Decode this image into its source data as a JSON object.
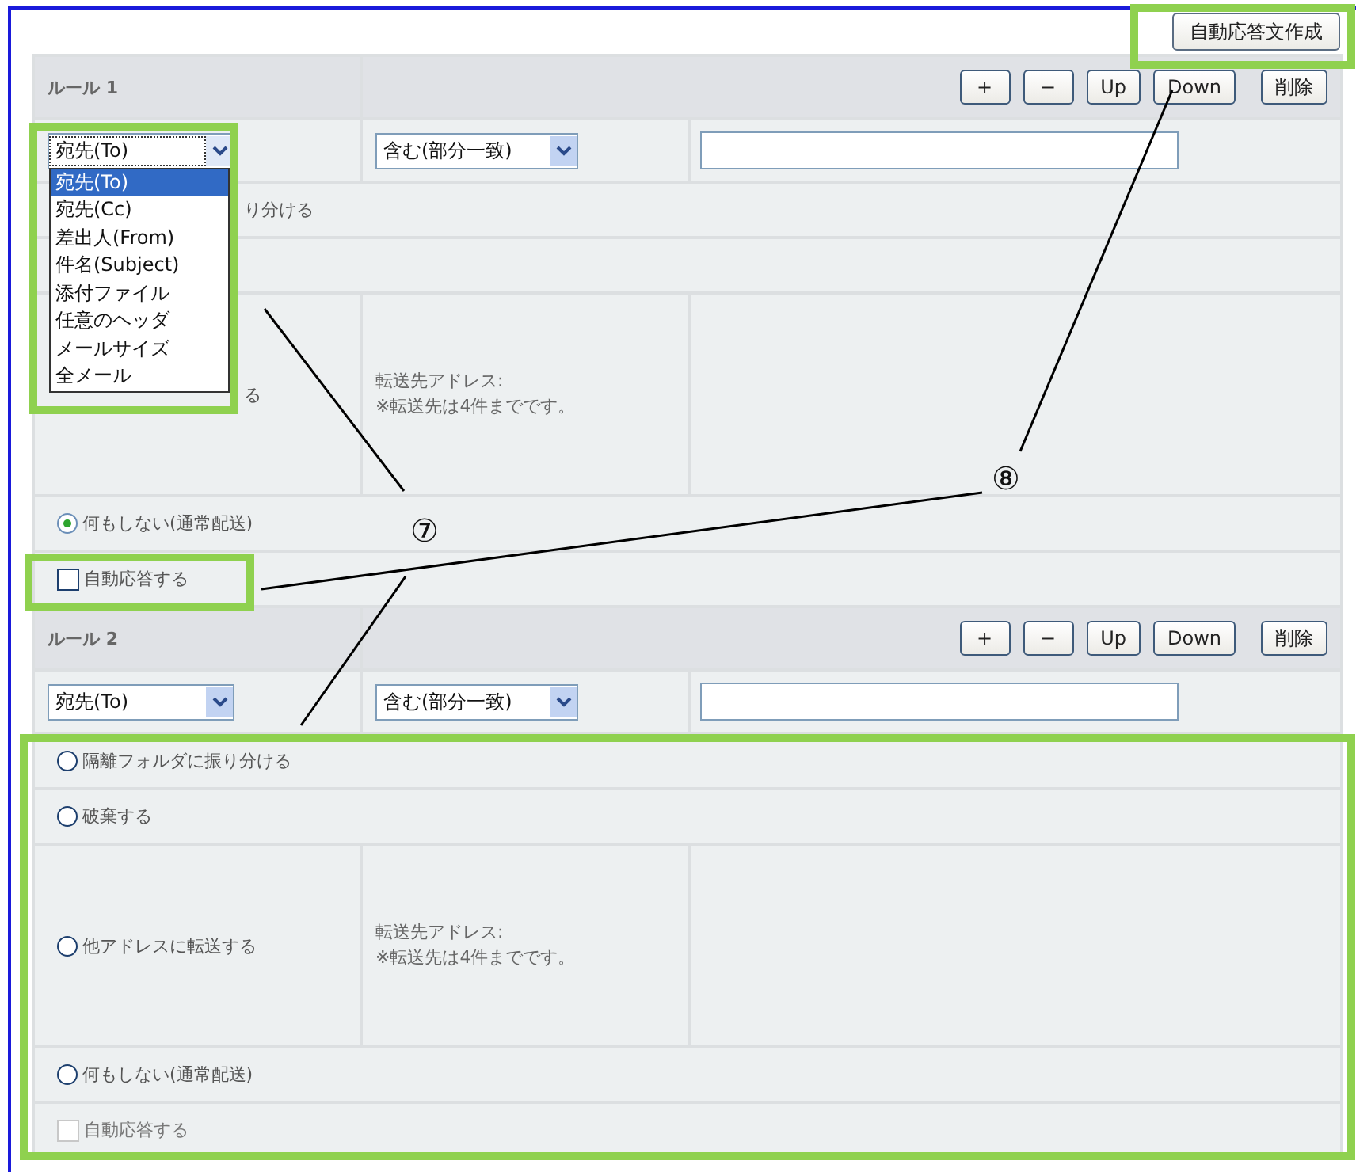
{
  "top_button": {
    "label": "自動応答文作成"
  },
  "rules": [
    {
      "title": "ルール 1",
      "buttons": [
        "+",
        "−",
        "Up",
        "Down",
        "削除"
      ],
      "field_select": {
        "value": "宛先(To)",
        "open": true,
        "options": [
          {
            "label": "宛先(To)",
            "selected": true
          },
          {
            "label": "宛先(Cc)",
            "selected": false
          },
          {
            "label": "差出人(From)",
            "selected": false
          },
          {
            "label": "件名(Subject)",
            "selected": false
          },
          {
            "label": "添付ファイル",
            "selected": false
          },
          {
            "label": "任意のヘッダ",
            "selected": false
          },
          {
            "label": "メールサイズ",
            "selected": false
          },
          {
            "label": "全メール",
            "selected": false
          }
        ]
      },
      "match_select": {
        "value": "含む(部分一致)"
      },
      "actions": [
        {
          "kind": "radio",
          "label": "り分ける",
          "covered": true
        },
        {
          "kind": "radio",
          "covered": true
        },
        {
          "kind": "forward",
          "label": "る",
          "covered": true,
          "note": [
            "転送先アドレス:",
            "※転送先は4件までです。"
          ]
        },
        {
          "kind": "radio",
          "label": "何もしない(通常配送)",
          "covered": false,
          "selected": true
        },
        {
          "kind": "checkbox",
          "label": "自動応答する",
          "checked": false,
          "disabled": false
        }
      ]
    },
    {
      "title": "ルール 2",
      "buttons": [
        "+",
        "−",
        "Up",
        "Down",
        "削除"
      ],
      "field_select": {
        "value": "宛先(To)",
        "open": false
      },
      "match_select": {
        "value": "含む(部分一致)"
      },
      "actions": [
        {
          "kind": "radio",
          "label": "隔離フォルダに振り分ける",
          "covered": false,
          "selected": false
        },
        {
          "kind": "radio",
          "label": "破棄する",
          "covered": false,
          "selected": false
        },
        {
          "kind": "forward",
          "label": "他アドレスに転送する",
          "covered": false,
          "selected": false,
          "note": [
            "転送先アドレス:",
            "※転送先は4件までです。"
          ]
        },
        {
          "kind": "radio",
          "label": "何もしない(通常配送)",
          "covered": false,
          "selected": false
        },
        {
          "kind": "checkbox",
          "label": "自動応答する",
          "checked": false,
          "disabled": true
        }
      ]
    }
  ],
  "annotations": [
    {
      "label": "⑦"
    },
    {
      "label": "⑧"
    }
  ]
}
